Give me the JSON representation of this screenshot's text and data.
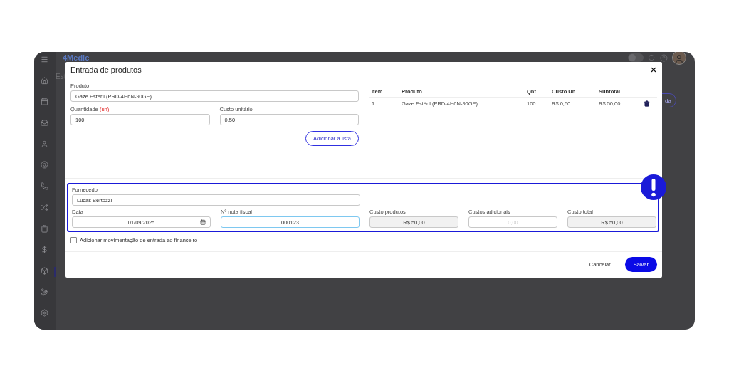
{
  "app": {
    "logo": "4Medic",
    "breadcrumb": "Est",
    "background_button": "da",
    "theme_toggle": {
      "on": false
    }
  },
  "sidebar": {
    "items": [
      {
        "selected": false
      },
      {
        "selected": false
      },
      {
        "selected": false
      },
      {
        "selected": false
      },
      {
        "selected": false
      },
      {
        "selected": false
      },
      {
        "selected": false
      },
      {
        "selected": false
      },
      {
        "selected": false
      },
      {
        "selected": false
      },
      {
        "selected": true
      },
      {
        "selected": false
      },
      {
        "selected": false
      }
    ]
  },
  "modal": {
    "title": "Entrada de produtos",
    "product": {
      "label": "Produto",
      "value": "Gaze Estéril (PRD-4H6N-90GE)"
    },
    "quantity": {
      "label": "Quantidade",
      "unit": "(un)",
      "value": "100"
    },
    "unit_cost": {
      "label": "Custo unitário",
      "value": "0,50"
    },
    "add_button": "Adicionar a lista",
    "table": {
      "columns": [
        "Item",
        "Produto",
        "Qnt",
        "Custo Un",
        "Subtotal"
      ],
      "rows": [
        {
          "cells": [
            "1",
            "Gaze Estéril (PRD-4H6N-90GE)",
            "100",
            "R$ 0,50",
            "R$ 50,00"
          ]
        }
      ]
    },
    "supplier": {
      "label": "Fornecedor",
      "value": "Lucas Bertozzi"
    },
    "details": [
      {
        "kind": "date",
        "label": "Data",
        "value": "01/09/2025",
        "readonly": false,
        "focused": false
      },
      {
        "kind": "text",
        "label": "Nº nota fiscal",
        "value": "000123",
        "readonly": false,
        "focused": true
      },
      {
        "kind": "text",
        "label": "Custo produtos",
        "value": "R$ 50,00",
        "readonly": true,
        "focused": false
      },
      {
        "kind": "text",
        "label": "Custos adicionais",
        "placeholder": "0,00",
        "readonly": false,
        "focused": false
      },
      {
        "kind": "text",
        "label": "Custo total",
        "value": "R$ 50,00",
        "readonly": true,
        "focused": false
      }
    ],
    "finance_checkbox": {
      "label": "Adicionar movimentação de entrada ao financeiro",
      "checked": false
    },
    "buttons": {
      "cancel": "Cancelar",
      "save": "Salvar"
    }
  }
}
